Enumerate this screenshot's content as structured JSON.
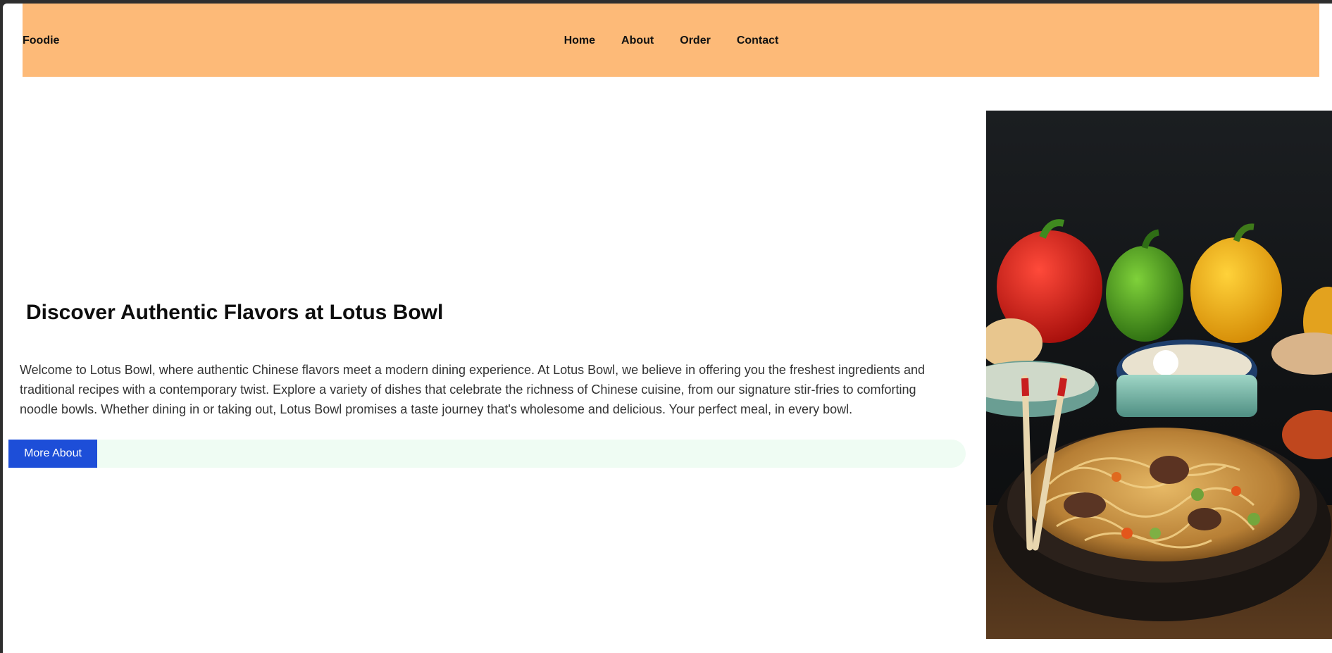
{
  "nav": {
    "brand": "Foodie",
    "links": [
      "Home",
      "About",
      "Order",
      "Contact"
    ]
  },
  "hero": {
    "title": "Discover Authentic Flavors at Lotus Bowl",
    "description": "Welcome to Lotus Bowl, where authentic Chinese flavors meet a modern dining experience. At Lotus Bowl, we believe in offering you the freshest ingredients and traditional recipes with a contemporary twist. Explore a variety of dishes that celebrate the richness of Chinese cuisine, from our signature stir-fries to comforting noodle bowls. Whether dining in or taking out, Lotus Bowl promises a taste journey that's wholesome and delicious. Your perfect meal, in every bowl.",
    "button_label": "More About"
  },
  "colors": {
    "header_bg": "#fdba78",
    "button_bg": "#1d4ed8",
    "cta_track_bg": "#effcf3",
    "window_frame": "#2e2e2e"
  },
  "image": {
    "icon": "noodle-bowl-photo"
  }
}
